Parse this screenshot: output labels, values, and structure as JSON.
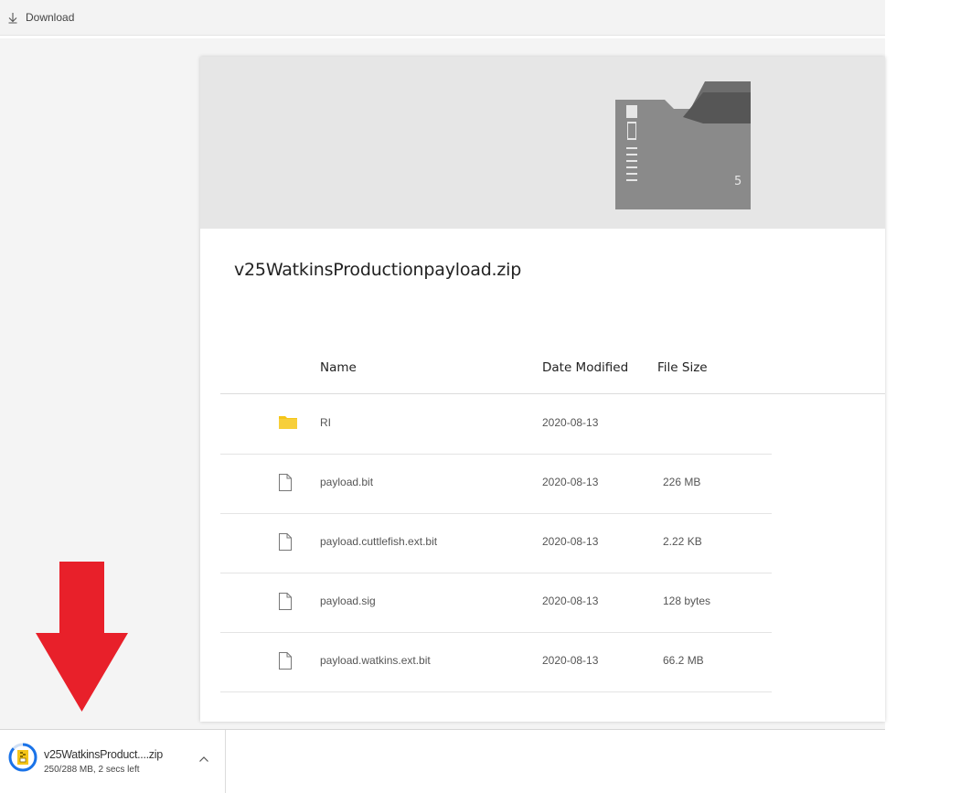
{
  "toolbar": {
    "download_label": "Download"
  },
  "zip_preview": {
    "icon": "zip-folder-icon",
    "badge": "5"
  },
  "file": {
    "title": "v25WatkinsProductionpayload.zip"
  },
  "table": {
    "columns": {
      "name": "Name",
      "date": "Date Modified",
      "size": "File Size"
    },
    "rows": [
      {
        "icon": "folder-icon",
        "name": "RI",
        "date": "2020-08-13",
        "size": ""
      },
      {
        "icon": "file-icon",
        "name": "payload.bit",
        "date": "2020-08-13",
        "size": "226 MB"
      },
      {
        "icon": "file-icon",
        "name": "payload.cuttlefish.ext.bit",
        "date": "2020-08-13",
        "size": "2.22 KB"
      },
      {
        "icon": "file-icon",
        "name": "payload.sig",
        "date": "2020-08-13",
        "size": "128 bytes"
      },
      {
        "icon": "file-icon",
        "name": "payload.watkins.ext.bit",
        "date": "2020-08-13",
        "size": "66.2 MB"
      }
    ]
  },
  "download_bar": {
    "file_name": "v25WatkinsProduct....zip",
    "status": "250/288 MB, 2 secs left",
    "progress_fraction": 0.87
  },
  "colors": {
    "arrow": "#e8202a",
    "folder": "#f5c518",
    "zip_gray": "#8a8a8a"
  }
}
